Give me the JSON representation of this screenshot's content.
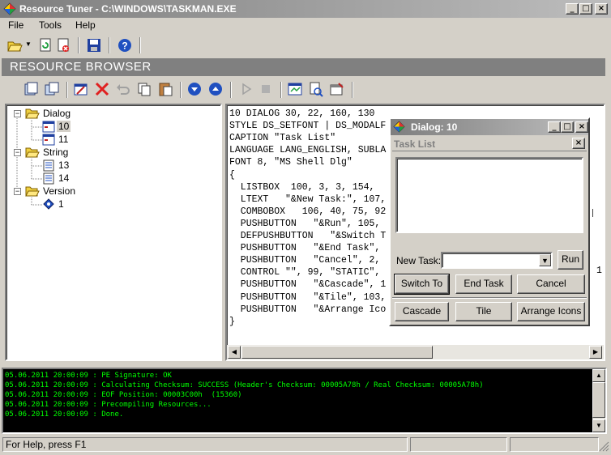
{
  "window": {
    "title": "Resource Tuner - C:\\WINDOWS\\TASKMAN.EXE",
    "min": "_",
    "max": "□",
    "close": "×"
  },
  "menu": {
    "file": "File",
    "tools": "Tools",
    "help": "Help"
  },
  "section_header": "RESOURCE BROWSER",
  "tree": {
    "dialog": "Dialog",
    "dialog_items": [
      "10",
      "11"
    ],
    "string": "String",
    "string_items": [
      "13",
      "14"
    ],
    "version": "Version",
    "version_items": [
      "1"
    ]
  },
  "code_lines": [
    "10 DIALOG 30, 22, 160, 130",
    "STYLE DS_SETFONT | DS_MODALF",
    "CAPTION \"Task List\"",
    "LANGUAGE LANG_ENGLISH, SUBLA",
    "FONT 8, \"MS Shell Dlg\"",
    "{",
    "  LISTBOX  100, 3, 3, 154,",
    "  LTEXT   \"&New Task:\", 107,",
    "  COMBOBOX   106, 40, 75, 92",
    "  PUSHBUTTON   \"&Run\", 105,",
    "  DEFPUSHBUTTON   \"&Switch T",
    "  PUSHBUTTON   \"&End Task\",",
    "  PUSHBUTTON   \"Cancel\", 2,",
    "  CONTROL \"\", 99, \"STATIC\",",
    "  PUSHBUTTON   \"&Cascade\", 1",
    "  PUSHBUTTON   \"&Tile\", 103,",
    "  PUSHBUTTON   \"&Arrange Ico",
    "}"
  ],
  "code_overflow_char": "1",
  "dialog": {
    "title": "Dialog: 10",
    "inner_title": "Task List",
    "new_task_label": "New Task:",
    "run": "Run",
    "switch_to": "Switch To",
    "end_task": "End Task",
    "cancel": "Cancel",
    "cascade": "Cascade",
    "tile": "Tile",
    "arrange_icons": "Arrange Icons"
  },
  "log": [
    "05.06.2011 20:00:09 : PE Signature: OK",
    "05.06.2011 20:00:09 : Calculating Checksum: SUCCESS (Header's Checksum: 00005A78h / Real Checksum: 00005A78h)",
    "05.06.2011 20:00:09 : EOF Position: 00003C00h  (15360)",
    "05.06.2011 20:00:09 : Precompiling Resources...",
    "05.06.2011 20:00:09 : Done."
  ],
  "status": "For Help, press F1",
  "colors": {
    "titlebar": "#7e7e7e",
    "log_text": "#00ff00",
    "log_bg": "#000000",
    "face": "#d4d0c8"
  }
}
